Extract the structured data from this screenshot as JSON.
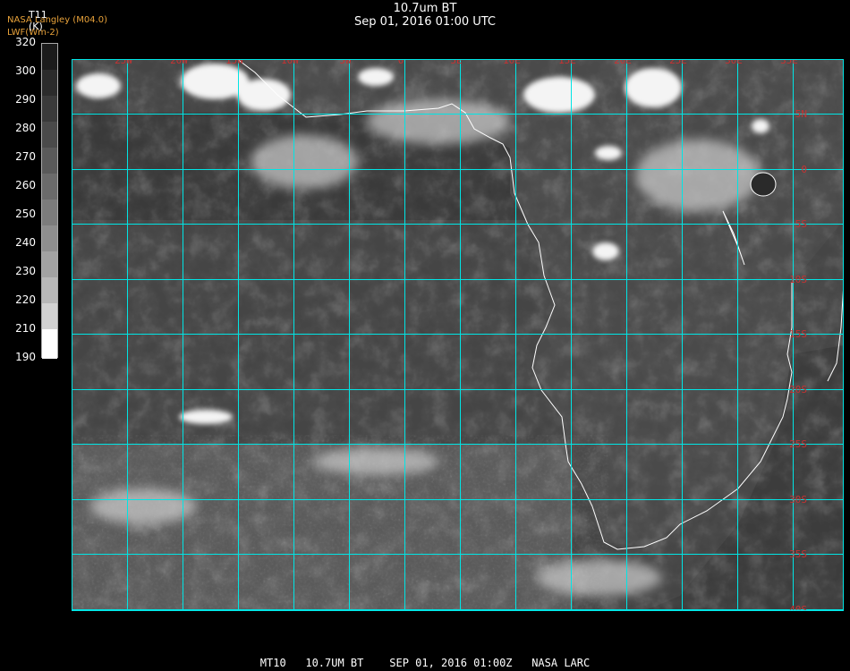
{
  "header": {
    "title": "10.7um BT",
    "datetime": "Sep 01, 2016 01:00 UTC",
    "source_line1": "NASA Langley (M04.0)",
    "source_line2": "LWF(Wm-2)"
  },
  "colorbar": {
    "variable": "T11",
    "units": "(K)",
    "ticks": [
      "320",
      "300",
      "290",
      "280",
      "270",
      "260",
      "250",
      "240",
      "230",
      "220",
      "210",
      "190"
    ],
    "colors": [
      "#1b1b1b",
      "#2b2b2b",
      "#3a3a3a",
      "#4a4a4a",
      "#5a5a5a",
      "#6b6b6b",
      "#7c7c7c",
      "#8e8e8e",
      "#a2a2a2",
      "#b8b8b8",
      "#d2d2d2",
      "#ffffff"
    ]
  },
  "map": {
    "lon_labels": [
      "25W",
      "20W",
      "15W",
      "10W",
      "5W",
      "0",
      "5E",
      "10E",
      "15E",
      "20E",
      "25E",
      "30E",
      "35E"
    ],
    "lat_labels": [
      "5N",
      "0",
      "5S",
      "10S",
      "15S",
      "20S",
      "25S",
      "30S",
      "35S",
      "40S"
    ],
    "grid_color": "#00e5e5",
    "coast_color": "#ffffff",
    "label_color": "#c83232"
  },
  "footer": {
    "text": "MT10   10.7UM BT    SEP 01, 2016 01:00Z   NASA LARC"
  }
}
